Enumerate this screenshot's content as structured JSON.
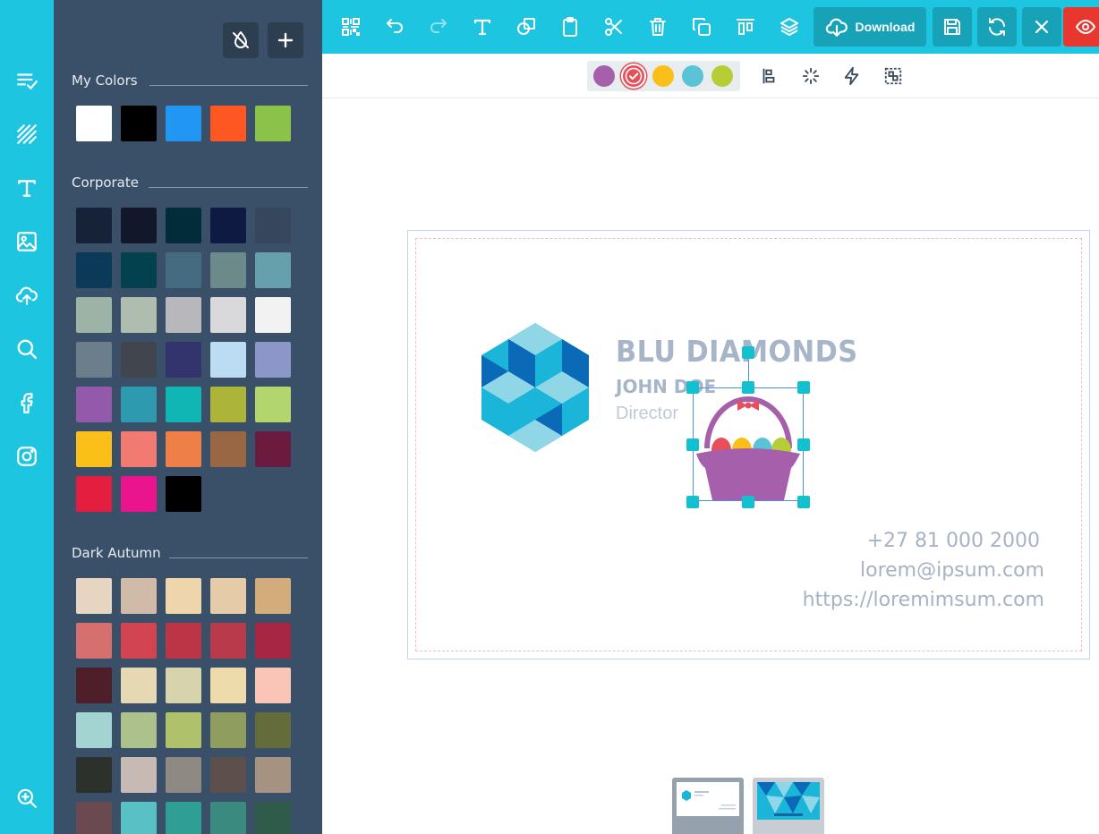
{
  "rail": {
    "items": [
      "templates-icon",
      "backgrounds-icon",
      "text-icon",
      "image-icon",
      "upload-icon",
      "search-icon",
      "facebook-icon",
      "instagram-icon",
      "zoom-in-icon"
    ]
  },
  "panel": {
    "sections": {
      "my_colors": {
        "title": "My Colors",
        "colors": [
          "#ffffff",
          "#000000",
          "#2196f3",
          "#ff5722",
          "#8bc34a"
        ]
      },
      "corporate": {
        "title": "Corporate",
        "colors": [
          "#152237",
          "#121829",
          "#022c39",
          "#0f1a42",
          "#36465c",
          "#0b3a59",
          "#03414f",
          "#456b81",
          "#6d8a8a",
          "#66a0ad",
          "#9db3a5",
          "#aebdb0",
          "#b7b7bc",
          "#d9d9db",
          "#f2f2f2",
          "#6c7e8c",
          "#41454e",
          "#33336e",
          "#bcdcf4",
          "#8d96c9",
          "#9359aa",
          "#2e9aaf",
          "#10b6b4",
          "#adb43a",
          "#b2d56e",
          "#fbbf19",
          "#f27b71",
          "#ee8047",
          "#9a6744",
          "#6b1c3e",
          "#e31e3e",
          "#ea148c",
          "#000000"
        ]
      },
      "dark_autumn": {
        "title": "Dark Autumn",
        "colors": [
          "#e6d5c1",
          "#d0baa8",
          "#eed5ac",
          "#e6cba8",
          "#d2ad7b",
          "#d6706e",
          "#d24550",
          "#bb3546",
          "#b93a4a",
          "#a62643",
          "#4e1e29",
          "#e6d8b2",
          "#d7d3ad",
          "#eedbab",
          "#fac4b6",
          "#a4d4d2",
          "#adc18c",
          "#b0c16b",
          "#8f9e5f",
          "#636c3a",
          "#2c322b",
          "#c7bab4",
          "#8e8983",
          "#5d4f4c",
          "#a59281",
          "#6a4a50",
          "#58c1c5",
          "#2f9f96",
          "#3b8a7f",
          "#2f5b4a"
        ]
      }
    }
  },
  "toolbar": {
    "items": [
      "qr-code-icon",
      "undo-icon",
      "redo-icon",
      "text-icon",
      "shape-icon",
      "paste-icon",
      "cut-icon",
      "delete-icon",
      "duplicate-icon",
      "align-top-icon",
      "layers-icon"
    ],
    "download_label": "Download"
  },
  "subbar": {
    "palette_colors": [
      "#a55fab",
      "#e94f5a",
      "#fbbf19",
      "#5bc3d6",
      "#b7cd36"
    ],
    "selected_color_index": 1
  },
  "card": {
    "company": "BLU DIAMONDS",
    "person": "JOHN DOE",
    "role": "Director",
    "phone": "+27 81 000 2000",
    "email": "lorem@ipsum.com",
    "website": "https://loremimsum.com"
  },
  "colors": {
    "accent": "#1ec5e0",
    "panel_bg": "#3a5068",
    "preview_red": "#e8372e",
    "handle": "#13c0cf"
  }
}
